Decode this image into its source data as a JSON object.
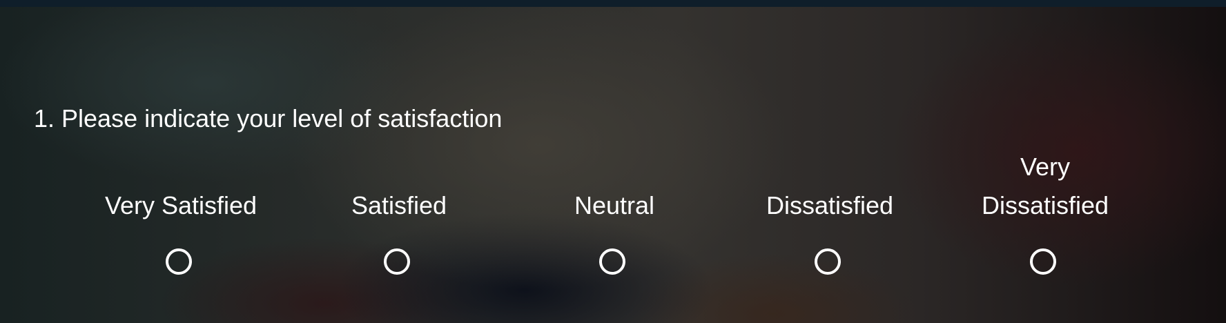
{
  "survey": {
    "question": "1. Please indicate your level of satisfaction",
    "options": [
      {
        "label": "Very Satisfied",
        "selected": false
      },
      {
        "label": "Satisfied",
        "selected": false
      },
      {
        "label": "Neutral",
        "selected": false
      },
      {
        "label": "Dissatisfied",
        "selected": false
      },
      {
        "label": "Very Dissatisfied",
        "selected": false
      }
    ]
  }
}
